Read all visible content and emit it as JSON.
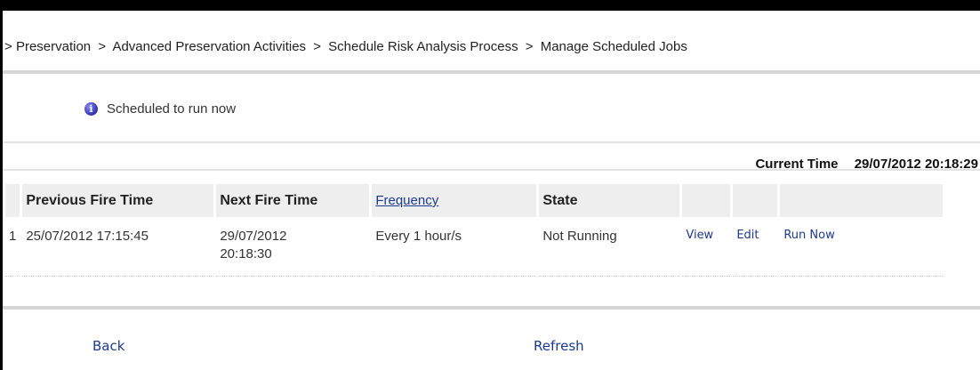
{
  "breadcrumb": {
    "lead_separator": ">",
    "items": [
      "Preservation",
      "Advanced Preservation Activities",
      "Schedule Risk Analysis Process",
      "Manage Scheduled Jobs"
    ],
    "separator": ">"
  },
  "message": {
    "icon": "info-icon",
    "text": "Scheduled to run now"
  },
  "current_time": {
    "label": "Current Time",
    "value": "29/07/2012 20:18:29"
  },
  "table": {
    "headers": {
      "previous_fire_time": "Previous Fire Time",
      "next_fire_time": "Next Fire Time",
      "frequency": "Frequency",
      "state": "State"
    },
    "rows": [
      {
        "index": "1",
        "previous_fire_time": "25/07/2012 17:15:45",
        "next_fire_time_date": "29/07/2012",
        "next_fire_time_time": "20:18:30",
        "frequency": "Every 1 hour/s",
        "state": "Not Running",
        "view_label": "View",
        "edit_label": "Edit",
        "run_now_label": "Run Now"
      }
    ]
  },
  "footer": {
    "back_label": "Back",
    "refresh_label": "Refresh"
  },
  "colors": {
    "link": "#1d3a8f",
    "header_bg": "#eeeeee",
    "border": "#000000"
  }
}
